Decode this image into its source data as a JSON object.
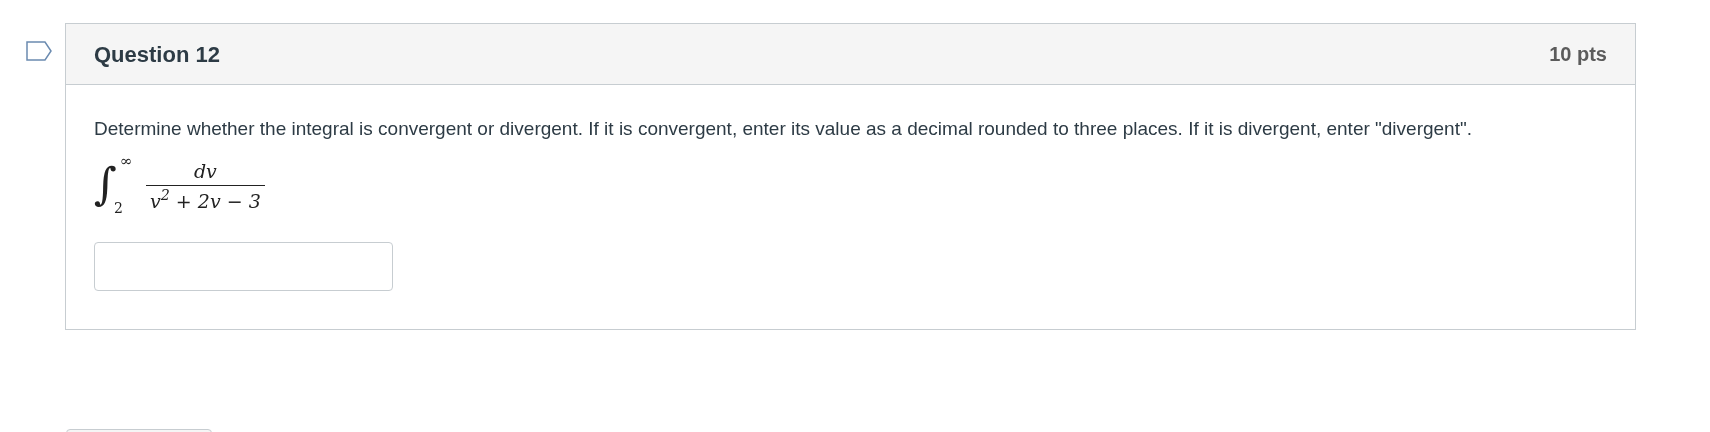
{
  "question": {
    "title": "Question 12",
    "points": "10 pts",
    "flagged": false,
    "prompt": "Determine whether the integral is convergent or divergent. If it is convergent, enter its value as a decimal rounded to three places. If it is divergent, enter \"divergent\".",
    "integral": {
      "sign": "∫",
      "upper": "∞",
      "lower": "2",
      "numerator": "dv",
      "denominator": "v$^{2}$ + 2v − 3"
    }
  }
}
